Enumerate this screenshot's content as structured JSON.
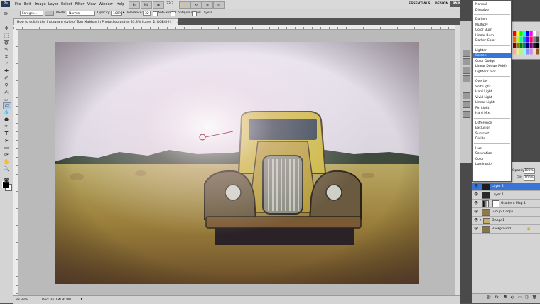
{
  "menubar": {
    "ps_logo": "Ps",
    "items": [
      "File",
      "Edit",
      "Image",
      "Layer",
      "Select",
      "Filter",
      "View",
      "Window",
      "Help"
    ],
    "zoom": "33.3",
    "workspaces": [
      "ESSENTIALS",
      "DESIGN",
      "PAINTING"
    ]
  },
  "options": {
    "brush_preset": "Foregro...",
    "mode_label": "Mode:",
    "mode_value": "Normal",
    "opacity_label": "Opacity:",
    "opacity_value": "100%",
    "tolerance_label": "Tolerance:",
    "tolerance_value": "32",
    "antialias_label": "Anti-alias",
    "contiguous_label": "Contiguous",
    "all_layers_label": "All Layers"
  },
  "document": {
    "tab_title": "How to edit in the Instagram style of Tom Mabhan in Photoshop.psd @ 33.3% (Layer 2, RGB/8#) *",
    "close_icon": "×"
  },
  "status": {
    "zoom": "33.33%",
    "doc_info": "Doc: 26.7M/36.8M"
  },
  "blend_menu": {
    "groups": [
      [
        "Normal",
        "Dissolve"
      ],
      [
        "Darken",
        "Multiply",
        "Color Burn",
        "Linear Burn",
        "Darker Color"
      ],
      [
        "Lighten",
        "Screen",
        "Color Dodge",
        "Linear Dodge (Add)",
        "Lighter Color"
      ],
      [
        "Overlay",
        "Soft Light",
        "Hard Light",
        "Vivid Light",
        "Linear Light",
        "Pin Light",
        "Hard Mix"
      ],
      [
        "Difference",
        "Exclusion",
        "Subtract",
        "Divide"
      ],
      [
        "Hue",
        "Saturation",
        "Color",
        "Luminosity"
      ]
    ],
    "highlighted": "Screen"
  },
  "layers_panel": {
    "opacity_label": "Opacity:",
    "opacity_value": "100%",
    "fill_label": "Fill:",
    "fill_value": "100%",
    "layers": [
      {
        "name": "Layer 2",
        "selected": true
      },
      {
        "name": "Layer 1",
        "selected": false
      },
      {
        "name": "Gradient Map 1",
        "selected": false
      },
      {
        "name": "Group 1 copy",
        "selected": false
      },
      {
        "name": "Group 1",
        "selected": false
      },
      {
        "name": "Background",
        "selected": false
      }
    ]
  },
  "colors": {
    "selection": "#3875d7",
    "workspace_bg": "#535353",
    "canvas_bg": "#bababa"
  }
}
